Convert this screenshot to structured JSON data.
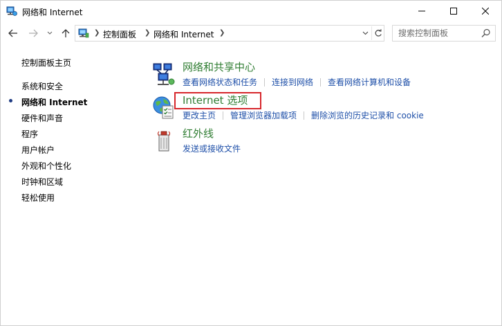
{
  "window": {
    "title": "网络和 Internet",
    "icons": {
      "app": "network-icon",
      "minimize": "minimize-icon",
      "maximize": "maximize-icon",
      "close": "close-icon"
    }
  },
  "nav": {
    "breadcrumb": [
      "控制面板",
      "网络和 Internet"
    ],
    "icons": {
      "back": "back-arrow-icon",
      "forward": "forward-arrow-icon",
      "recent": "chevron-down-icon",
      "up": "up-arrow-icon",
      "refresh": "refresh-icon"
    },
    "search": {
      "placeholder": "搜索控制面板",
      "value": ""
    }
  },
  "sidebar": {
    "items": [
      {
        "label": "控制面板主页",
        "active": false
      },
      {
        "label": "系统和安全",
        "active": false
      },
      {
        "label": "网络和 Internet",
        "active": true
      },
      {
        "label": "硬件和声音",
        "active": false
      },
      {
        "label": "程序",
        "active": false
      },
      {
        "label": "用户帐户",
        "active": false
      },
      {
        "label": "外观和个性化",
        "active": false
      },
      {
        "label": "时钟和区域",
        "active": false
      },
      {
        "label": "轻松使用",
        "active": false
      }
    ]
  },
  "main": {
    "categories": [
      {
        "title": "网络和共享中心",
        "icon": "network-sharing-icon",
        "links": [
          "查看网络状态和任务",
          "连接到网络",
          "查看网络计算机和设备"
        ]
      },
      {
        "title": "Internet 选项",
        "icon": "internet-options-icon",
        "highlighted": true,
        "links": [
          "更改主页",
          "管理浏览器加载项",
          "删除浏览的历史记录和 cookie"
        ]
      },
      {
        "title": "红外线",
        "icon": "infrared-icon",
        "links": [
          "发送或接收文件"
        ]
      }
    ]
  },
  "colors": {
    "category_title": "#2f7d32",
    "task_link": "#1e4fa8",
    "highlight_border": "#d6262b",
    "active_dot": "#1f3b83"
  }
}
